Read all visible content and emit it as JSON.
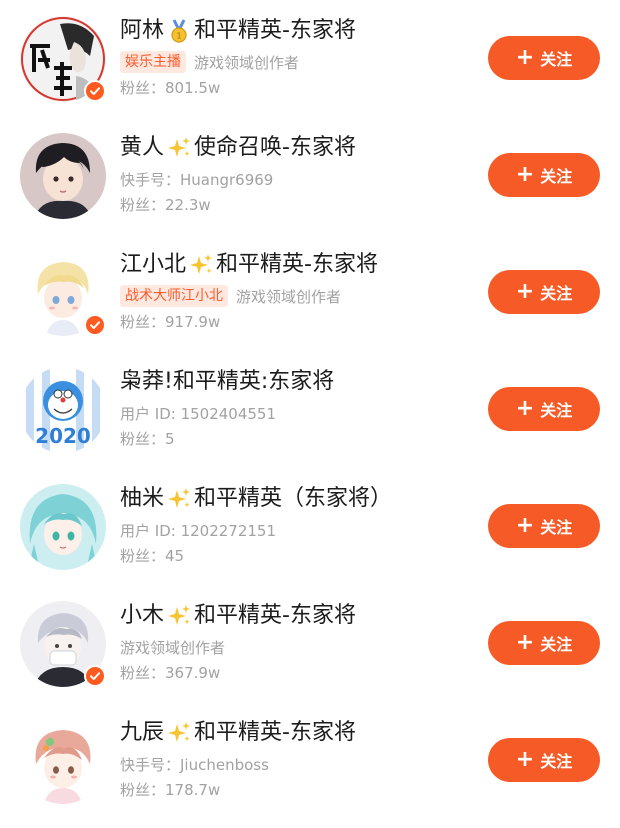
{
  "follow_label": "关注",
  "accent_color": "#f65a26",
  "users": [
    {
      "name_before": "阿林",
      "emoji": "medal-icon",
      "name_after": "和平精英-东家将",
      "tag": "娱乐主播",
      "subtitle": "游戏领域创作者",
      "fans": "粉丝：801.5w",
      "verified": true
    },
    {
      "name_before": "黄人",
      "emoji": "sparkles-icon",
      "name_after": "使命召唤-东家将",
      "tag": "",
      "subtitle": "快手号：Huangr6969",
      "fans": "粉丝：22.3w",
      "verified": false
    },
    {
      "name_before": "江小北",
      "emoji": "sparkles-icon",
      "name_after": "和平精英-东家将",
      "tag": "战术大师江小北",
      "subtitle": "游戏领域创作者",
      "fans": "粉丝：917.9w",
      "verified": true
    },
    {
      "name_before": "枭莽!和平精英:东家将",
      "emoji": "",
      "name_after": "",
      "tag": "",
      "subtitle": "用户 ID: 1502404551",
      "fans": "粉丝：5",
      "verified": false
    },
    {
      "name_before": "柚米",
      "emoji": "sparkles-icon",
      "name_after": "和平精英（东家将）",
      "tag": "",
      "subtitle": "用户 ID: 1202272151",
      "fans": "粉丝：45",
      "verified": false
    },
    {
      "name_before": "小木",
      "emoji": "sparkles-icon",
      "name_after": "和平精英-东家将",
      "tag": "",
      "subtitle": "游戏领域创作者",
      "fans": "粉丝：367.9w",
      "verified": true
    },
    {
      "name_before": "九辰",
      "emoji": "sparkles-icon",
      "name_after": "和平精英-东家将",
      "tag": "",
      "subtitle": "快手号：Jiuchenboss",
      "fans": "粉丝：178.7w",
      "verified": false
    }
  ]
}
